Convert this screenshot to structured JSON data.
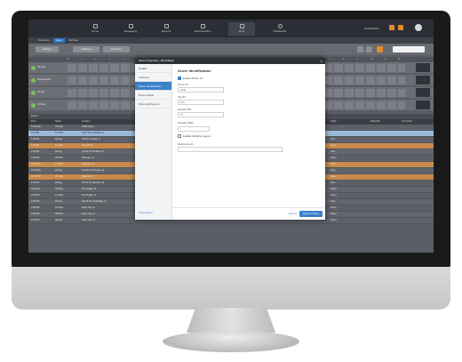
{
  "nav": {
    "items": [
      {
        "label": "Home"
      },
      {
        "label": "Messaging"
      },
      {
        "label": "Reports"
      },
      {
        "label": "Administration"
      },
      {
        "label": "ELD"
      },
      {
        "label": "Dashboard"
      }
    ],
    "user": "NetDispatch"
  },
  "tabs": [
    "Overview",
    "Logs",
    "Vehicles"
  ],
  "toolbar": {
    "buttons": [
      "Refresh",
      "Add Event",
      "Edit Event",
      "Certify",
      "Edit History",
      "Edit Driver"
    ]
  },
  "grid": {
    "hours": [
      "M",
      "1",
      "2",
      "3",
      "4",
      "5",
      "6",
      "7",
      "8",
      "9",
      "10",
      "11",
      "N",
      "1",
      "2",
      "3",
      "4",
      "5",
      "6",
      "7",
      "8",
      "9",
      "10",
      "11",
      "M"
    ],
    "tracks": [
      {
        "label": "Off Duty"
      },
      {
        "label": "Sleeper Berth"
      },
      {
        "label": "Driving"
      },
      {
        "label": "On Duty"
      }
    ]
  },
  "events": {
    "title": "Events",
    "headers": [
      "Time",
      "Status",
      "Location",
      "Vehicle",
      "Odometer",
      "Notes",
      "Origin",
      "Edited By",
      "Comments"
    ],
    "rows": [
      {
        "time": "12:00 AM",
        "status": "Off Duty",
        "location": "Initial status",
        "origin": "",
        "style": "normal"
      },
      {
        "time": "5:14 AM",
        "status": "On Duty",
        "location": "Near Yard, Chicago, IL",
        "origin": "",
        "style": "sel"
      },
      {
        "time": "5:38 AM",
        "status": "Driving",
        "location": "I-90 W, Chicago, IL",
        "origin": "Auto",
        "style": "normal"
      },
      {
        "time": "7:02 AM",
        "status": "On Duty",
        "location": "Rockford, IL",
        "origin": "Driver",
        "style": "orange"
      },
      {
        "time": "7:31 AM",
        "status": "Driving",
        "location": "US-20 W, Rockford, IL",
        "origin": "Auto",
        "style": "alt"
      },
      {
        "time": "9:45 AM",
        "status": "Off Duty",
        "location": "Dubuque, IA",
        "origin": "Driver",
        "style": "normal"
      },
      {
        "time": "10:15 AM",
        "status": "On Duty",
        "location": "Dubuque, IA",
        "origin": "Driver",
        "style": "orange"
      },
      {
        "time": "10:40 AM",
        "status": "Driving",
        "location": "US-20 W, Dubuque, IA",
        "origin": "Auto",
        "style": "alt"
      },
      {
        "time": "12:55 PM",
        "status": "On Duty",
        "location": "Waterloo, IA",
        "origin": "Driver",
        "style": "orange"
      },
      {
        "time": "1:20 PM",
        "status": "Driving",
        "location": "US-20 W, Waterloo, IA",
        "origin": "Auto",
        "style": "normal"
      },
      {
        "time": "3:10 PM",
        "status": "Off Duty",
        "location": "Fort Dodge, IA",
        "origin": "Driver",
        "style": "alt"
      },
      {
        "time": "4:00 PM",
        "status": "On Duty",
        "location": "Fort Dodge, IA",
        "origin": "Driver",
        "style": "normal"
      },
      {
        "time": "4:30 PM",
        "status": "Driving",
        "location": "US-20 W, Fort Dodge, IA",
        "origin": "Auto",
        "style": "alt"
      },
      {
        "time": "6:05 PM",
        "status": "On Duty",
        "location": "Sioux City, IA",
        "origin": "Driver",
        "style": "normal"
      },
      {
        "time": "6:40 PM",
        "status": "Off Duty",
        "location": "Sioux City, IA",
        "origin": "Driver",
        "style": "alt"
      },
      {
        "time": "9:00 PM",
        "status": "Sleeper",
        "location": "Sioux City, IA",
        "origin": "Driver",
        "style": "normal"
      }
    ]
  },
  "modal": {
    "title": "Driver Properties - Brad Baker",
    "nav": [
      "Details",
      "Licenses",
      "Driver Identification",
      "Driver Portal",
      "Personal Devices"
    ],
    "active_nav": 2,
    "help": "Need Help?",
    "section_title": "Driver Identification",
    "checkbox_label": "Enable Driver ID",
    "fields": [
      {
        "label": "Driver ID",
        "value": "1234"
      },
      {
        "label": "Tag ID",
        "value": "123"
      },
      {
        "label": "Keyfob PIN",
        "value": "***"
      }
    ],
    "expand_label": "Expiry Date",
    "expiry_value": "",
    "second_checkbox": "Enable Multiple Logons",
    "note_label": "Reference Id",
    "note_placeholder": "",
    "cancel": "Cancel",
    "save": "Save & Close"
  }
}
